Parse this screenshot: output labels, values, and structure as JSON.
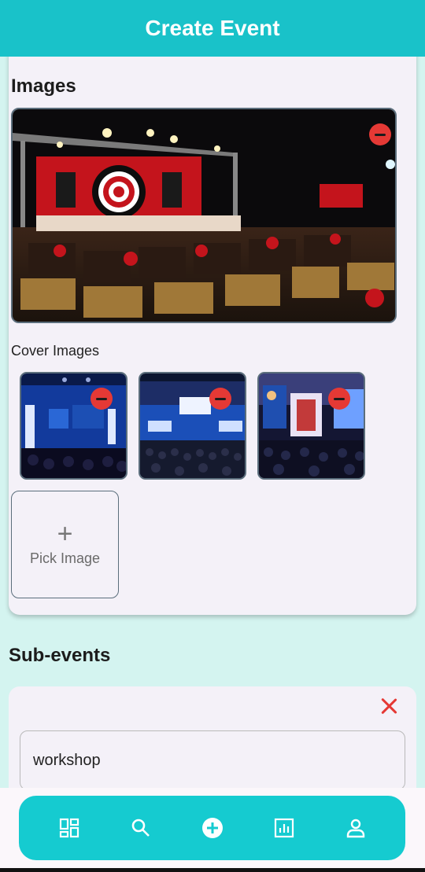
{
  "header": {
    "title": "Create Event"
  },
  "images_section": {
    "title": "Images",
    "cover_label": "Cover Images",
    "pick_image_label": "Pick Image",
    "pick_image_icon": "+"
  },
  "sub_events": {
    "title": "Sub-events",
    "items": [
      {
        "name": "workshop"
      }
    ]
  },
  "nav": {
    "items": [
      {
        "icon": "dashboard-icon"
      },
      {
        "icon": "search-icon"
      },
      {
        "icon": "add-circle-icon"
      },
      {
        "icon": "analytics-icon"
      },
      {
        "icon": "person-icon"
      }
    ]
  },
  "colors": {
    "accent": "#19c2c9",
    "remove": "#e53935",
    "card": "#f4f1f8",
    "background": "#d4f4f0"
  }
}
